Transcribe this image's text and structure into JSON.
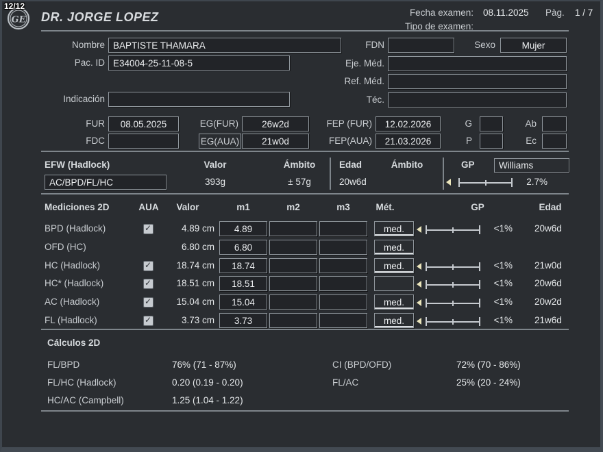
{
  "header": {
    "counter": "12/12",
    "doctor": "DR. JORGE LOPEZ",
    "exam_date_label": "Fecha examen:",
    "exam_date": "08.11.2025",
    "page_label": "Pàg.",
    "page": "1 / 7",
    "exam_type_label": "Tipo de examen:"
  },
  "patient": {
    "name_label": "Nombre",
    "name": "BAPTISTE THAMARA",
    "id_label": "Pac. ID",
    "id": "E34004-25-11-08-5",
    "fdn_label": "FDN",
    "fdn": "",
    "sex_label": "Sexo",
    "sex": "Mujer",
    "exec_md_label": "Eje. Méd.",
    "exec_md": "",
    "ref_md_label": "Ref. Méd.",
    "ref_md": "",
    "tech_label": "Téc.",
    "tech": "",
    "indication_label": "Indicación",
    "indication": ""
  },
  "dates": {
    "fur_label": "FUR",
    "fur": "08.05.2025",
    "eg_fur_label": "EG(FUR)",
    "eg_fur": "26w2d",
    "fep_fur_label": "FEP (FUR)",
    "fep_fur": "12.02.2026",
    "g_label": "G",
    "g": "",
    "ab_label": "Ab",
    "ab": "",
    "fdc_label": "FDC",
    "fdc": "",
    "eg_aua_label": "EG(AUA)",
    "eg_aua": "21w0d",
    "fep_aua_label": "FEP(AUA)",
    "fep_aua": "21.03.2026",
    "p_label": "P",
    "p": "",
    "ec_label": "Ec",
    "ec": ""
  },
  "efw": {
    "title": "EFW (Hadlock)",
    "col_valor": "Valor",
    "col_ambito": "Ámbito",
    "col_edad": "Edad",
    "col_ambito2": "Ámbito",
    "col_gp": "GP",
    "gp_method": "Williams",
    "formula": "AC/BPD/FL/HC",
    "valor": "393g",
    "ambito": "± 57g",
    "edad": "20w6d",
    "gp": "2.7%"
  },
  "measurements": {
    "title": "Mediciones 2D",
    "col_aua": "AUA",
    "col_valor": "Valor",
    "col_m1": "m1",
    "col_m2": "m2",
    "col_m3": "m3",
    "col_met": "Mét.",
    "col_gp": "GP",
    "col_edad": "Edad",
    "rows": [
      {
        "name": "BPD (Hadlock)",
        "aua": true,
        "valor": "4.89 cm",
        "m1": "4.89",
        "m2": "",
        "m3": "",
        "met": "med.",
        "gp": "<1%",
        "edad": "20w6d"
      },
      {
        "name": "OFD (HC)",
        "aua": false,
        "valor": "6.80 cm",
        "m1": "6.80",
        "m2": "",
        "m3": "",
        "met": "med.",
        "gp": "",
        "edad": ""
      },
      {
        "name": "HC (Hadlock)",
        "aua": true,
        "valor": "18.74 cm",
        "m1": "18.74",
        "m2": "",
        "m3": "",
        "met": "med.",
        "gp": "<1%",
        "edad": "21w0d"
      },
      {
        "name": "HC* (Hadlock)",
        "aua": true,
        "valor": "18.51 cm",
        "m1": "18.51",
        "m2": "",
        "m3": "",
        "met": "",
        "gp": "<1%",
        "edad": "20w6d"
      },
      {
        "name": "AC (Hadlock)",
        "aua": true,
        "valor": "15.04 cm",
        "m1": "15.04",
        "m2": "",
        "m3": "",
        "met": "med.",
        "gp": "<1%",
        "edad": "20w2d"
      },
      {
        "name": "FL (Hadlock)",
        "aua": true,
        "valor": "3.73 cm",
        "m1": "3.73",
        "m2": "",
        "m3": "",
        "met": "med.",
        "gp": "<1%",
        "edad": "21w6d"
      }
    ]
  },
  "calculations": {
    "title": "Cálculos 2D",
    "left": [
      {
        "label": "FL/BPD",
        "value": "76% (71 - 87%)"
      },
      {
        "label": "FL/HC (Hadlock)",
        "value": "0.20 (0.19 - 0.20)"
      },
      {
        "label": "HC/AC (Campbell)",
        "value": "1.25 (1.04 - 1.22)"
      }
    ],
    "right": [
      {
        "label": "CI (BPD/OFD)",
        "value": "72% (70 - 86%)"
      },
      {
        "label": "FL/AC",
        "value": "25% (20 - 24%)"
      }
    ]
  },
  "colors": {
    "background": "#2a2d31",
    "frame": "#434a52",
    "box_fill": "#222428",
    "box_border": "#8f969c",
    "label_text": "#c9cdd1",
    "value_text": "#eceef0",
    "gp_marker": "#ebe5bb"
  }
}
